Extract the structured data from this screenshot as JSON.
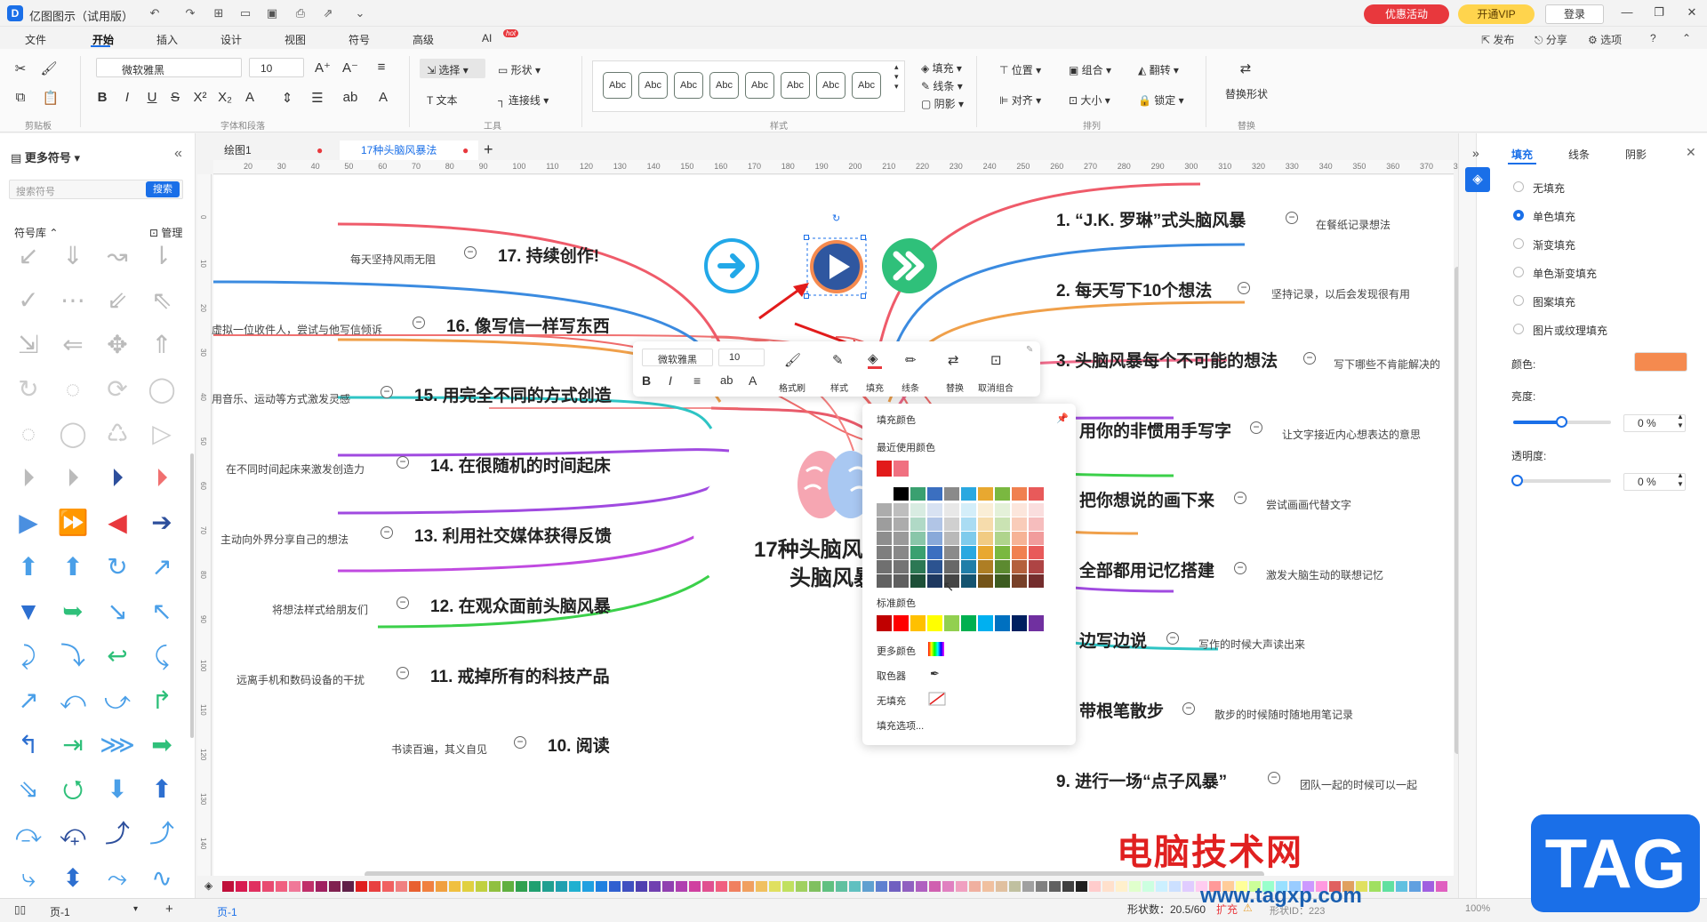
{
  "app": {
    "title": "亿图图示（试用版）",
    "promo": "优惠活动",
    "vip": "开通VIP",
    "login": "登录"
  },
  "menu": [
    "文件",
    "开始",
    "插入",
    "设计",
    "视图",
    "符号",
    "高级",
    "AI"
  ],
  "menu_hot": "hot",
  "right_menu": [
    "发布",
    "分享",
    "选项"
  ],
  "ribbon": {
    "font_name": "微软雅黑",
    "font_size": "10",
    "select": "选择",
    "shape": "形状",
    "text": "文本",
    "connector": "连接线",
    "fill": "填充",
    "line": "线条",
    "shadow": "阴影",
    "position": "位置",
    "group": "组合",
    "flip": "翻转",
    "align": "对齐",
    "size": "大小",
    "lock": "锁定",
    "replace_shape": "替换形状",
    "groups": [
      "剪贴板",
      "字体和段落",
      "工具",
      "样式",
      "排列",
      "替换"
    ],
    "style_samples": [
      "Abc",
      "Abc",
      "Abc",
      "Abc",
      "Abc",
      "Abc",
      "Abc",
      "Abc"
    ]
  },
  "left_panel": {
    "title": "更多符号",
    "search_placeholder": "搜索符号",
    "search_btn": "搜索",
    "library": "符号库",
    "manage": "管理"
  },
  "tabs": [
    {
      "label": "绘图1"
    },
    {
      "label": "17种头脑风暴法"
    }
  ],
  "ruler_h": [
    "20",
    "30",
    "40",
    "50",
    "60",
    "70",
    "80",
    "90",
    "100",
    "110",
    "120",
    "130",
    "140",
    "150",
    "160",
    "170",
    "180",
    "190",
    "200",
    "210",
    "220",
    "230",
    "240",
    "250",
    "260",
    "270",
    "280",
    "290",
    "300",
    "310",
    "320",
    "330",
    "340",
    "350",
    "360",
    "370",
    "380"
  ],
  "ruler_v": [
    "0",
    "10",
    "20",
    "30",
    "40",
    "50",
    "60",
    "70",
    "80",
    "90",
    "100",
    "110",
    "120",
    "130",
    "140",
    "150",
    "160"
  ],
  "center": {
    "line1": "17种头脑风",
    "line2": "头脑风暴"
  },
  "right_nodes": [
    {
      "title": "1. “J.K. 罗琳”式头脑风暴",
      "note": "在餐纸记录想法"
    },
    {
      "title": "2. 每天写下10个想法",
      "note": "坚持记录，以后会发现很有用"
    },
    {
      "title": "3. 头脑风暴每个不可能的想法",
      "note": "写下哪些不肯能解决的"
    },
    {
      "title": "用你的非惯用手写字",
      "note": "让文字接近内心想表达的意思"
    },
    {
      "title": "把你想说的画下来",
      "note": "尝试画画代替文字"
    },
    {
      "title": "全部都用记忆搭建",
      "note": "激发大脑生动的联想记忆"
    },
    {
      "title": "边写边说",
      "note": "写作的时候大声读出来"
    },
    {
      "title": "带根笔散步",
      "note": "散步的时候随时随地用笔记录"
    },
    {
      "title": "9. 进行一场“点子风暴”",
      "note": "团队一起的时候可以一起"
    }
  ],
  "left_nodes": [
    {
      "title": "17. 持续创作!",
      "note": "每天坚持风雨无阻"
    },
    {
      "title": "16. 像写信一样写东西",
      "note": "虚拟一位收件人，尝试与他写信倾诉"
    },
    {
      "title": "15. 用完全不同的方式创造",
      "note": "用音乐、运动等方式激发灵感"
    },
    {
      "title": "14. 在很随机的时间起床",
      "note": "在不同时间起床来激发创造力"
    },
    {
      "title": "13. 利用社交媒体获得反馈",
      "note": "主动向外界分享自己的想法"
    },
    {
      "title": "12. 在观众面前头脑风暴",
      "note": "将想法样式给朋友们"
    },
    {
      "title": "11. 戒掉所有的科技产品",
      "note": "远离手机和数码设备的干扰"
    },
    {
      "title": "10. 阅读",
      "note": "书读百遍，其义自见"
    }
  ],
  "float_toolbar": {
    "font": "微软雅黑",
    "size": "10",
    "items": [
      "格式刷",
      "样式",
      "填充",
      "线条",
      "替换",
      "取消组合"
    ]
  },
  "fill_popup": {
    "title": "填充颜色",
    "recent": "最近使用颜色",
    "standard": "标准颜色",
    "more": "更多颜色",
    "picker": "取色器",
    "none": "无填充",
    "options": "填充选项..."
  },
  "right_panel": {
    "tabs": [
      "填充",
      "线条",
      "阴影"
    ],
    "options": [
      "无填充",
      "单色填充",
      "渐变填充",
      "单色渐变填充",
      "图案填充",
      "图片或纹理填充"
    ],
    "selected": "单色填充",
    "color_label": "颜色:",
    "brightness_label": "亮度:",
    "brightness": "0 %",
    "transparency_label": "透明度:",
    "transparency": "0 %",
    "fill_color": "#f58a4f"
  },
  "status": {
    "page_dropdown": "页-1",
    "page_tab": "页-1",
    "shape_status": "形状数：20.5/60",
    "expand": "扩充",
    "shape_id": "形状ID：223",
    "zoom": "100%"
  },
  "watermark": {
    "text": "电脑技术网",
    "url": "www.tagxp.com",
    "tag": "TAG"
  },
  "colors": {
    "accent": "#1a6fe8",
    "promo": "#e8383d"
  }
}
